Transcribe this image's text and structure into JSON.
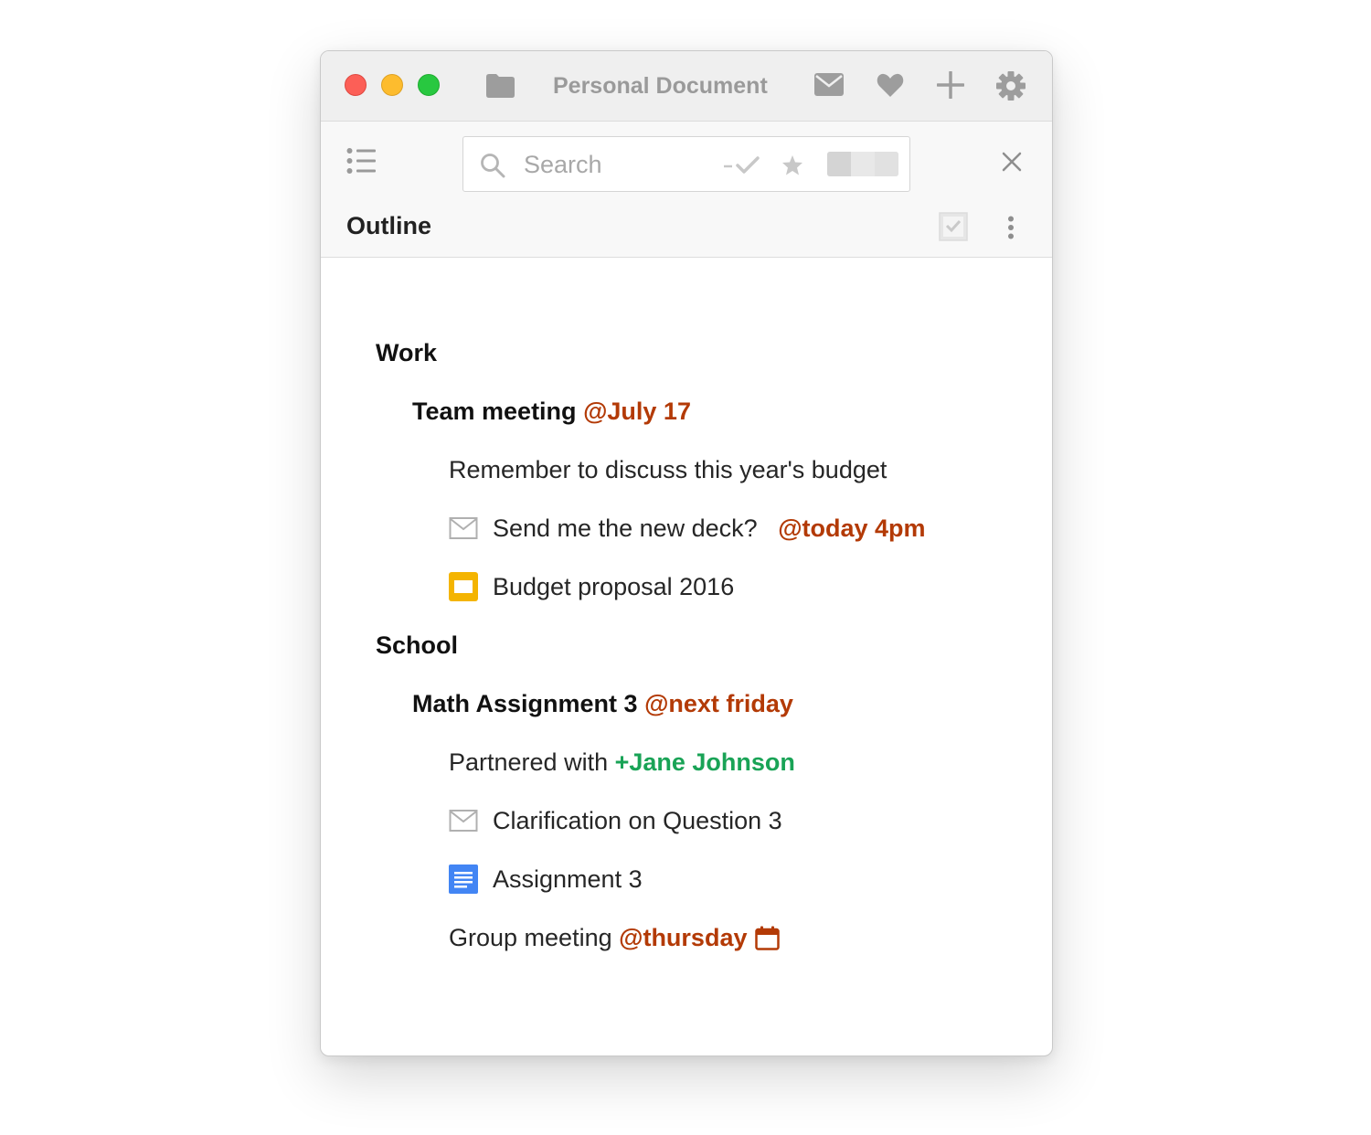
{
  "window": {
    "title": "Personal Document"
  },
  "toolbar": {
    "search_placeholder": "Search",
    "section_title": "Outline"
  },
  "outline": {
    "work": {
      "label": "Work",
      "meeting_label": "Team meeting",
      "meeting_tag": "@July 17",
      "note": "Remember to discuss this year's budget",
      "email_label": "Send me the new deck?",
      "email_tag": "@today 4pm",
      "slides_label": "Budget proposal 2016"
    },
    "school": {
      "label": "School",
      "assignment_label": "Math Assignment 3",
      "assignment_tag": "@next friday",
      "partner_prefix": "Partnered with",
      "partner_name": "+Jane Johnson",
      "email_label": "Clarification on Question 3",
      "doc_label": "Assignment 3",
      "group_label": "Group meeting",
      "group_tag": "@thursday"
    }
  },
  "icons": {
    "titlebar": [
      "folder-icon",
      "mail-icon",
      "heart-icon",
      "plus-icon",
      "gear-icon"
    ],
    "toolbar": [
      "list-icon",
      "search-icon",
      "done-filter-icon",
      "star-filter-icon",
      "toggle-switch",
      "close-icon",
      "checkbox-icon",
      "more-vertical-icon"
    ],
    "items": [
      "email-item-icon",
      "slides-icon",
      "docs-icon",
      "calendar-icon"
    ]
  },
  "colors": {
    "tag": "#b33a06",
    "person": "#19a356",
    "slides": "#f4b400",
    "docs": "#4285f4"
  }
}
